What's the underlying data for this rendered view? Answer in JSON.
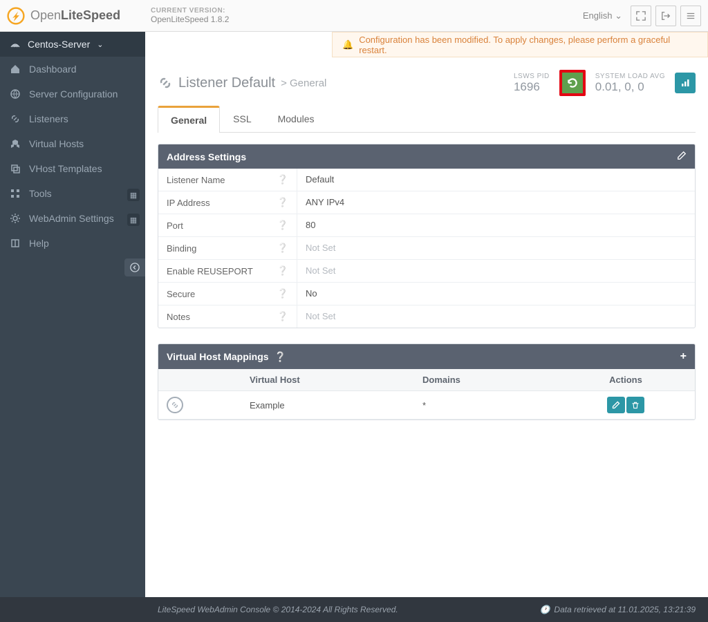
{
  "header": {
    "brand_open": "Open",
    "brand_bold": "LiteSpeed",
    "version_label": "CURRENT VERSION:",
    "version_value": "OpenLiteSpeed 1.8.2",
    "language": "English"
  },
  "sidebar": {
    "server_name": "Centos-Server",
    "items": [
      {
        "label": "Dashboard"
      },
      {
        "label": "Server Configuration"
      },
      {
        "label": "Listeners"
      },
      {
        "label": "Virtual Hosts"
      },
      {
        "label": "VHost Templates"
      },
      {
        "label": "Tools"
      },
      {
        "label": "WebAdmin Settings"
      },
      {
        "label": "Help"
      }
    ]
  },
  "alert": "Configuration has been modified. To apply changes, please perform a graceful restart.",
  "page": {
    "title_main": "Listener Default",
    "title_sub": "General",
    "pid_label": "LSWS PID",
    "pid_value": "1696",
    "load_label": "SYSTEM LOAD AVG",
    "load_value": "0.01, 0, 0"
  },
  "tabs": [
    "General",
    "SSL",
    "Modules"
  ],
  "panels": {
    "address": {
      "title": "Address Settings",
      "rows": [
        {
          "label": "Listener Name",
          "value": "Default",
          "notset": false
        },
        {
          "label": "IP Address",
          "value": "ANY IPv4",
          "notset": false
        },
        {
          "label": "Port",
          "value": "80",
          "notset": false
        },
        {
          "label": "Binding",
          "value": "Not Set",
          "notset": true
        },
        {
          "label": "Enable REUSEPORT",
          "value": "Not Set",
          "notset": true
        },
        {
          "label": "Secure",
          "value": "No",
          "notset": false
        },
        {
          "label": "Notes",
          "value": "Not Set",
          "notset": true
        }
      ]
    },
    "mappings": {
      "title": "Virtual Host Mappings",
      "columns": {
        "vh": "Virtual Host",
        "dom": "Domains",
        "act": "Actions"
      },
      "rows": [
        {
          "vhost": "Example",
          "domains": "*"
        }
      ]
    }
  },
  "footer": {
    "copyright": "LiteSpeed WebAdmin Console © 2014-2024 All Rights Reserved.",
    "retrieved": "Data retrieved at 11.01.2025, 13:21:39"
  }
}
